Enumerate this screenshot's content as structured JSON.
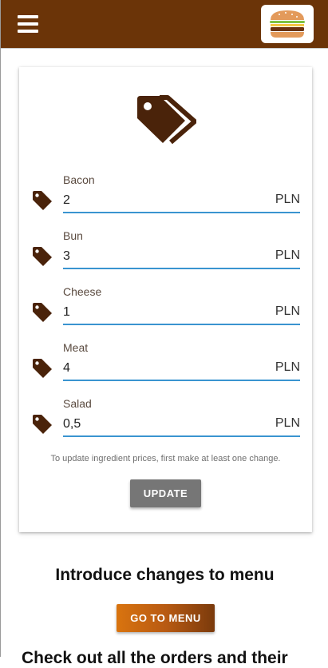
{
  "header": {
    "menu_icon": "hamburger-menu-icon",
    "logo_icon": "burger-logo-icon",
    "colors": {
      "bar": "#6b3408"
    }
  },
  "prices_card": {
    "hero_icon": "price-tags-icon",
    "fields": [
      {
        "label": "Bacon",
        "value": "2",
        "unit": "PLN",
        "icon": "price-tag-icon"
      },
      {
        "label": "Bun",
        "value": "3",
        "unit": "PLN",
        "icon": "price-tag-icon"
      },
      {
        "label": "Cheese",
        "value": "1",
        "unit": "PLN",
        "icon": "price-tag-icon"
      },
      {
        "label": "Meat",
        "value": "4",
        "unit": "PLN",
        "icon": "price-tag-icon"
      },
      {
        "label": "Salad",
        "value": "0,5",
        "unit": "PLN",
        "icon": "price-tag-icon"
      }
    ],
    "hint": "To update ingredient prices, first make at least one change.",
    "update_label": "UPDATE",
    "colors": {
      "tag": "#4a230a",
      "underline": "#3a94d0",
      "update_button": "#767676"
    }
  },
  "menu_section": {
    "title": "Introduce changes to menu",
    "button_label": "GO TO MENU",
    "colors": {
      "button_start": "#d9740f",
      "button_end": "#7a3a0c"
    }
  },
  "next_section": {
    "title_partial": "Check out all the orders and their"
  }
}
